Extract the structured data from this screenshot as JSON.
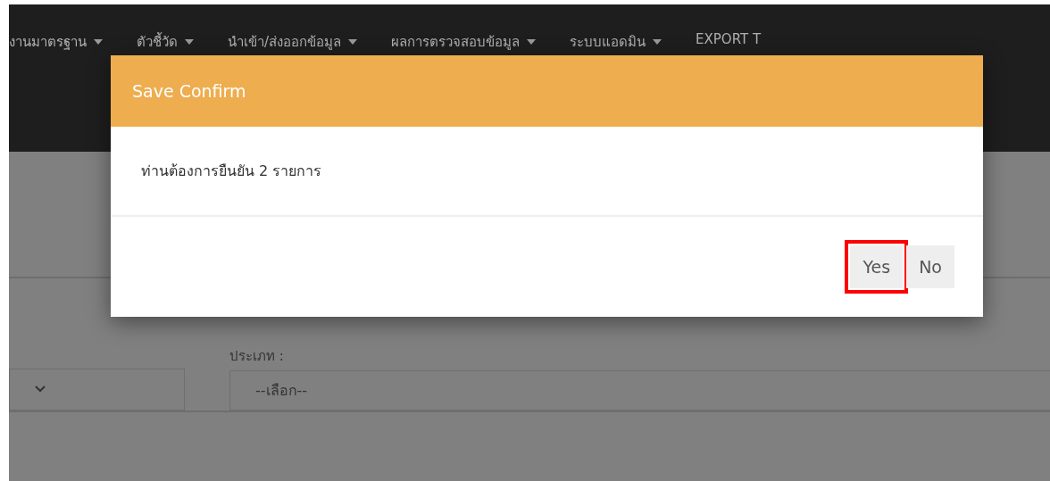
{
  "navbar": {
    "items": [
      {
        "label": "งานมาตรฐาน",
        "has_caret": true
      },
      {
        "label": "ตัวชี้วัด",
        "has_caret": true
      },
      {
        "label": "นำเข้า/ส่งออกข้อมูล",
        "has_caret": true
      },
      {
        "label": "ผลการตรวจสอบข้อมูล",
        "has_caret": true
      },
      {
        "label": "ระบบแอดมิน",
        "has_caret": true
      },
      {
        "label": "EXPORT T",
        "has_caret": false
      }
    ]
  },
  "filters": [
    {
      "kind": "dropdown"
    },
    {
      "kind": "labeled",
      "label": "ประเภท :",
      "value": "--เลือก--"
    }
  ],
  "dialog": {
    "title": "Save Confirm",
    "message": "ท่านต้องการยืนยัน 2 รายการ",
    "buttons": [
      {
        "label": "Yes",
        "highlighted": true
      },
      {
        "label": "No",
        "highlighted": false
      }
    ]
  }
}
